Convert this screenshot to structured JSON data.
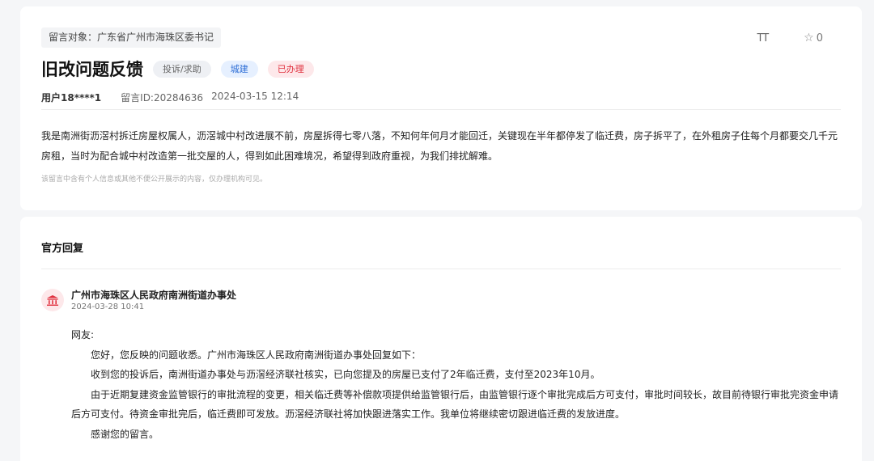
{
  "message": {
    "target": "留言对象：广东省广州市海珠区委书记",
    "font_toggle": "TT",
    "favorite_count": "0",
    "title": "旧改问题反馈",
    "tags": [
      "投诉/求助",
      "城建",
      "已办理"
    ],
    "user": "用户18****1",
    "message_id": "留言ID:20284636",
    "datetime": "2024-03-15 12:14",
    "content": "我是南洲街沥滘村拆迁房屋权属人，沥滘城中村改进展不前，房屋拆得七零八落，不知何年何月才能回迁，关键现在半年都停发了临迁费，房子拆平了，在外租房子住每个月都要交几千元房租，当时为配合城中村改造第一批交屋的人，得到如此困难境况，希望得到政府重视，为我们排扰解难。",
    "notice": "该留言中含有个人信息或其他不便公开展示的内容，仅办理机构可见。"
  },
  "reply": {
    "heading": "官方回复",
    "office": "广州市海珠区人民政府南洲街道办事处",
    "date": "2024-03-28 10:41",
    "greeting": "网友:",
    "paragraphs": [
      "您好，您反映的问题收悉。广州市海珠区人民政府南洲街道办事处回复如下：",
      "收到您的投诉后，南洲街道办事处与沥滘经济联社核实，已向您提及的房屋已支付了2年临迁费，支付至2023年10月。",
      "由于近期复建资金监管银行的审批流程的变更，相关临迁费等补偿款项提供给监管银行后，由监管银行逐个审批完成后方可支付，审批时间较长，故目前待银行审批完资金申请后方可支付。待资金审批完后，临迁费即可发放。沥滘经济联社将加快跟进落实工作。我单位将继续密切跟进临迁费的发放进度。",
      "感谢您的留言。"
    ]
  },
  "colors": {
    "accent_red": "#e0313f",
    "accent_blue": "#2f6fd6",
    "background": "#f5f6f8"
  },
  "icons": {
    "font_size": "font-size-icon",
    "favorite": "star-icon",
    "office": "government-building-icon"
  }
}
